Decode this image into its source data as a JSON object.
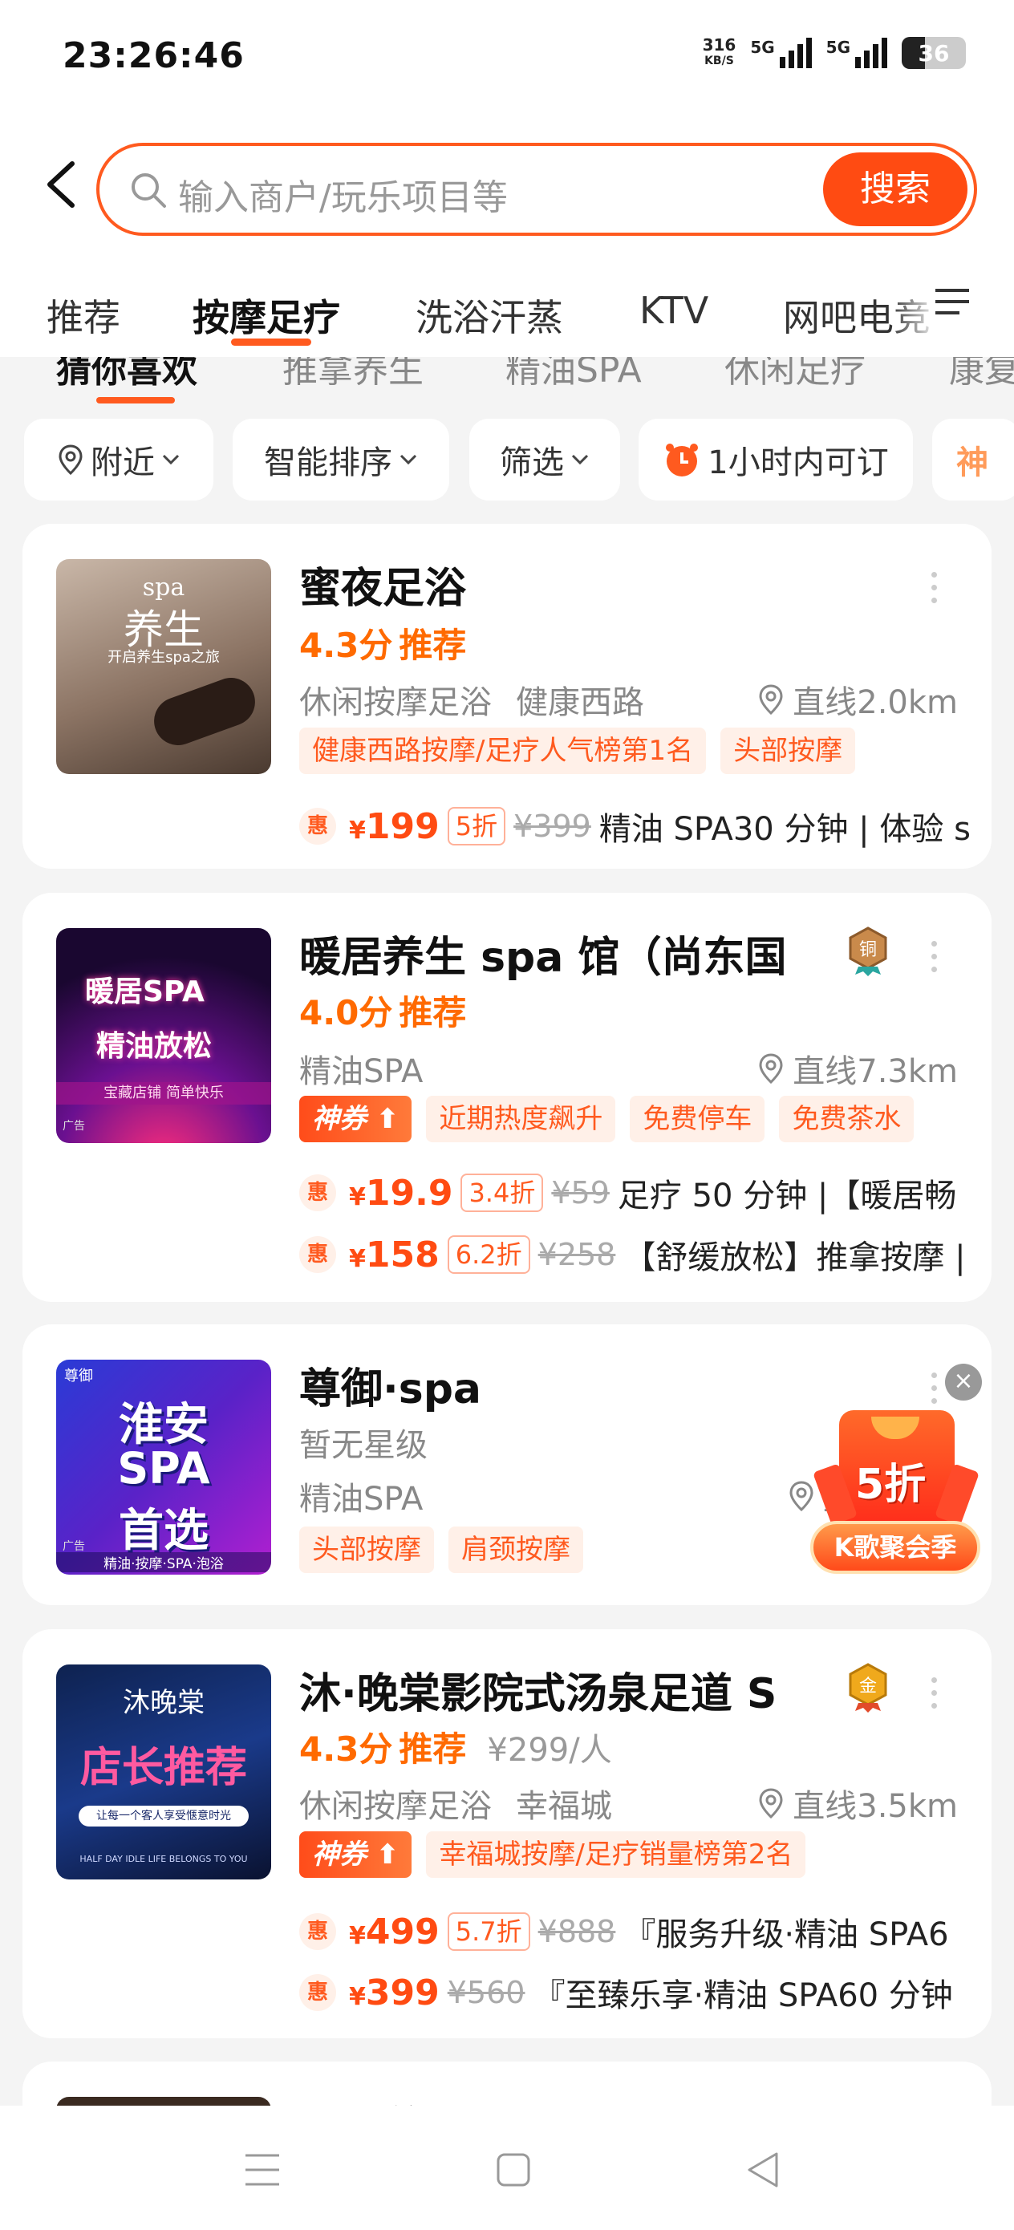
{
  "status": {
    "time": "23:26:46",
    "net_speed_value": "316",
    "net_speed_unit": "KB/S",
    "sim1": "5G",
    "sim2": "5G",
    "battery": "36"
  },
  "search": {
    "placeholder": "输入商户/玩乐项目等",
    "button": "搜索"
  },
  "category_tabs": [
    "推荐",
    "按摩足疗",
    "洗浴汗蒸",
    "KTV",
    "网吧电竞"
  ],
  "sub_tabs": [
    "猜你喜欢",
    "推拿养生",
    "精油SPA",
    "休闲足疗",
    "康复"
  ],
  "filters": {
    "nearby": "附近",
    "sort": "智能排序",
    "filter": "筛选",
    "bookable": "1小时内可订",
    "extra": "神"
  },
  "promo": {
    "discount": "5折",
    "label": "K歌聚会季"
  },
  "shops": [
    {
      "name": "蜜夜足浴",
      "score": "4.3分",
      "recommend": "推荐",
      "category": "休闲按摩足浴",
      "area": "健康西路",
      "distance": "直线2.0km",
      "tags": [
        "健康西路按摩/足疗人气榜第1名",
        "头部按摩"
      ],
      "deals": [
        {
          "hui": "惠",
          "currency": "¥",
          "price": "199",
          "discount": "5折",
          "original": "¥399",
          "desc": "精油 SPA30 分钟 | 体验 s"
        }
      ],
      "thumb": {
        "line1": "spa",
        "line2": "养生",
        "line3": "开启养生spa之旅"
      }
    },
    {
      "name": "暖居养生 spa 馆（尚东国",
      "medal": "铜",
      "score": "4.0分",
      "recommend": "推荐",
      "category": "精油SPA",
      "distance": "直线7.3km",
      "hot_tag": "神券",
      "tags": [
        "近期热度飙升",
        "免费停车",
        "免费茶水"
      ],
      "deals": [
        {
          "hui": "惠",
          "currency": "¥",
          "price": "19.9",
          "discount": "3.4折",
          "original": "¥59",
          "desc": "足疗 50 分钟 |【暖居畅"
        },
        {
          "hui": "惠",
          "currency": "¥",
          "price": "158",
          "discount": "6.2折",
          "original": "¥258",
          "desc": "【舒缓放松】推拿按摩 |"
        }
      ],
      "thumb": {
        "line1": "暖居SPA",
        "line2": "精油放松",
        "line3": "宝藏店铺  简单快乐",
        "ad": "广告"
      }
    },
    {
      "name": "尊御·spa",
      "rating_text": "暂无星级",
      "category": "精油SPA",
      "distance": "直",
      "tags": [
        "头部按摩",
        "肩颈按摩"
      ],
      "thumb": {
        "brand": "尊御",
        "line1": "淮安",
        "line2": "SPA",
        "line3": "首选",
        "line4": "精油·按摩·SPA·泡浴",
        "ad": "广告"
      }
    },
    {
      "name": "沐·晚棠影院式汤泉足道 S",
      "medal": "金",
      "score": "4.3分",
      "recommend": "推荐",
      "per_person": "¥299/人",
      "category": "休闲按摩足浴",
      "area": "幸福城",
      "distance": "直线3.5km",
      "hot_tag": "神券",
      "tags": [
        "幸福城按摩/足疗销量榜第2名"
      ],
      "deals": [
        {
          "hui": "惠",
          "currency": "¥",
          "price": "499",
          "discount": "5.7折",
          "original": "¥888",
          "desc": "『服务升级·精油 SPA6"
        },
        {
          "hui": "惠",
          "currency": "¥",
          "price": "399",
          "original": "¥560",
          "desc": "『至臻乐享·精油 SPA60 分钟"
        }
      ],
      "thumb": {
        "line1": "沐晚棠",
        "line2": "店长推荐",
        "line3": "让每一个客人享受惬意时光",
        "line4": "HALF DAY IDLE LIFE BELONGS TO YOU"
      }
    },
    {
      "name": "显城养生"
    }
  ]
}
